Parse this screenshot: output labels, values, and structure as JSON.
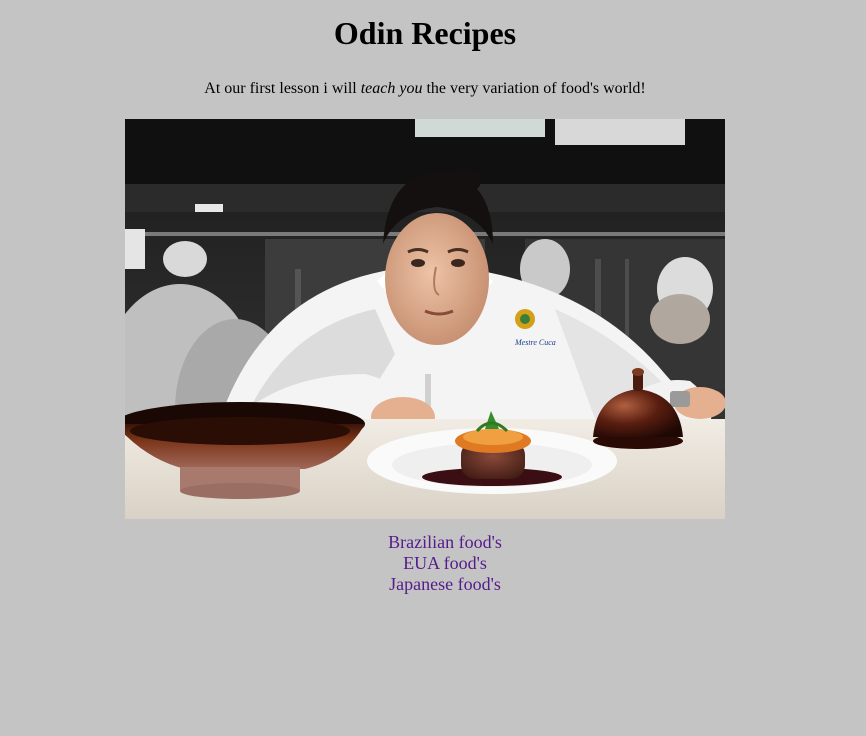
{
  "header": {
    "title": "Odin Recipes"
  },
  "intro": {
    "before": "At our first lesson i will ",
    "emphasis": "teach you",
    "after": " the very variation of food's world!"
  },
  "photo": {
    "badge_text": "Mestre Cuca"
  },
  "links": [
    {
      "label": "Brazilian food's"
    },
    {
      "label": "EUA food's"
    },
    {
      "label": "Japanese food's"
    }
  ],
  "colors": {
    "background": "#c4c4c4",
    "visited_link": "#551a8b"
  }
}
